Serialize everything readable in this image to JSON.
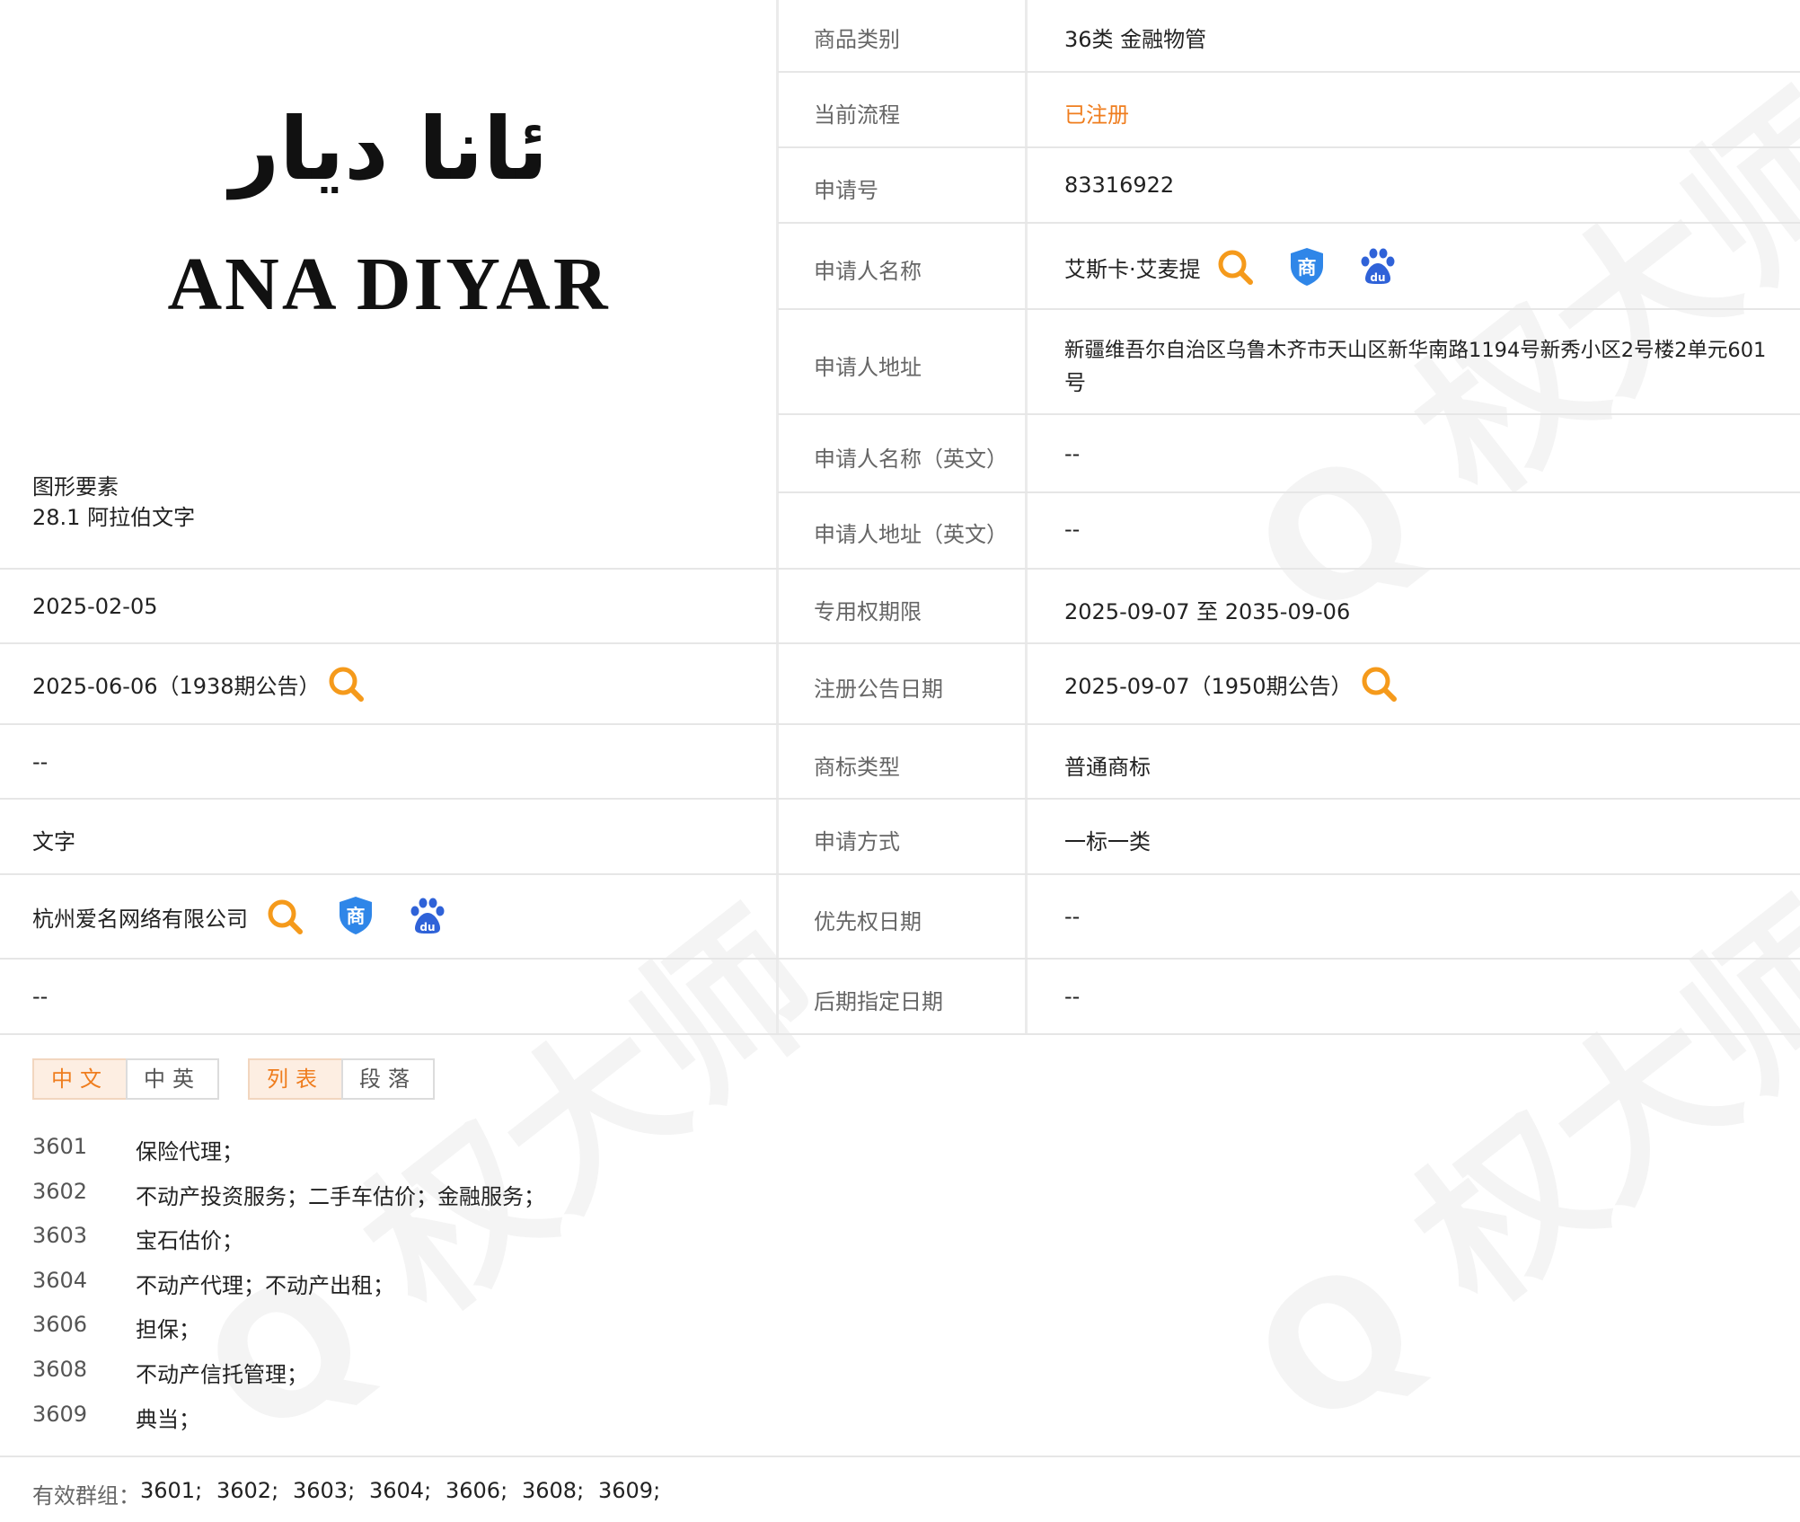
{
  "mark": {
    "arabic_text": "ئانا ديار",
    "latin_text": "ANA DIYAR",
    "graphic_elements_label": "图形要素",
    "graphic_elements_value": "28.1 阿拉伯文字"
  },
  "right_fields": [
    {
      "label": "商品类别",
      "value": "36类 金融物管"
    },
    {
      "label": "当前流程",
      "value": "已注册"
    },
    {
      "label": "申请号",
      "value": "83316922"
    },
    {
      "label": "申请人名称",
      "value": "艾斯卡·艾麦提"
    },
    {
      "label": "申请人地址",
      "value_line1": "新疆维吾尔自治区乌鲁木齐市天山区新华南路1194号新秀小区2号楼2单元601",
      "value_line2": "号"
    },
    {
      "label": "申请人名称（英文）",
      "value": "--"
    },
    {
      "label": "申请人地址（英文）",
      "value": "--"
    },
    {
      "label": "专用权期限",
      "value": "2025-09-07 至 2035-09-06"
    },
    {
      "label": "注册公告日期",
      "value": "2025-09-07（1950期公告）"
    },
    {
      "label": "商标类型",
      "value": "普通商标"
    },
    {
      "label": "申请方式",
      "value": "一标一类"
    },
    {
      "label": "优先权日期",
      "value": "--"
    },
    {
      "label": "后期指定日期",
      "value": "--"
    }
  ],
  "left_values": [
    "2025-02-05",
    "2025-06-06（1938期公告）",
    "--",
    "文字",
    "杭州爱名网络有限公司",
    "--"
  ],
  "toggles": {
    "lang": [
      "中文",
      "中英"
    ],
    "view": [
      "列表",
      "段落"
    ]
  },
  "services": [
    {
      "code": "3601",
      "text": "保险代理；"
    },
    {
      "code": "3602",
      "text": "不动产投资服务；二手车估价；金融服务；"
    },
    {
      "code": "3603",
      "text": "宝石估价；"
    },
    {
      "code": "3604",
      "text": "不动产代理；不动产出租；"
    },
    {
      "code": "3606",
      "text": "担保；"
    },
    {
      "code": "3608",
      "text": "不动产信托管理；"
    },
    {
      "code": "3609",
      "text": "典当；"
    }
  ],
  "valid_groups": {
    "label": "有效群组：",
    "codes": [
      "3601;",
      "3602;",
      "3603;",
      "3604;",
      "3606;",
      "3608;",
      "3609;"
    ]
  },
  "colors": {
    "accent_orange": "#ef7d1e",
    "shield_blue": "#2f86e8",
    "baidu_blue": "#2f62d8"
  },
  "icons": [
    "search-icon",
    "shield-shang-icon",
    "baidu-paw-icon"
  ]
}
